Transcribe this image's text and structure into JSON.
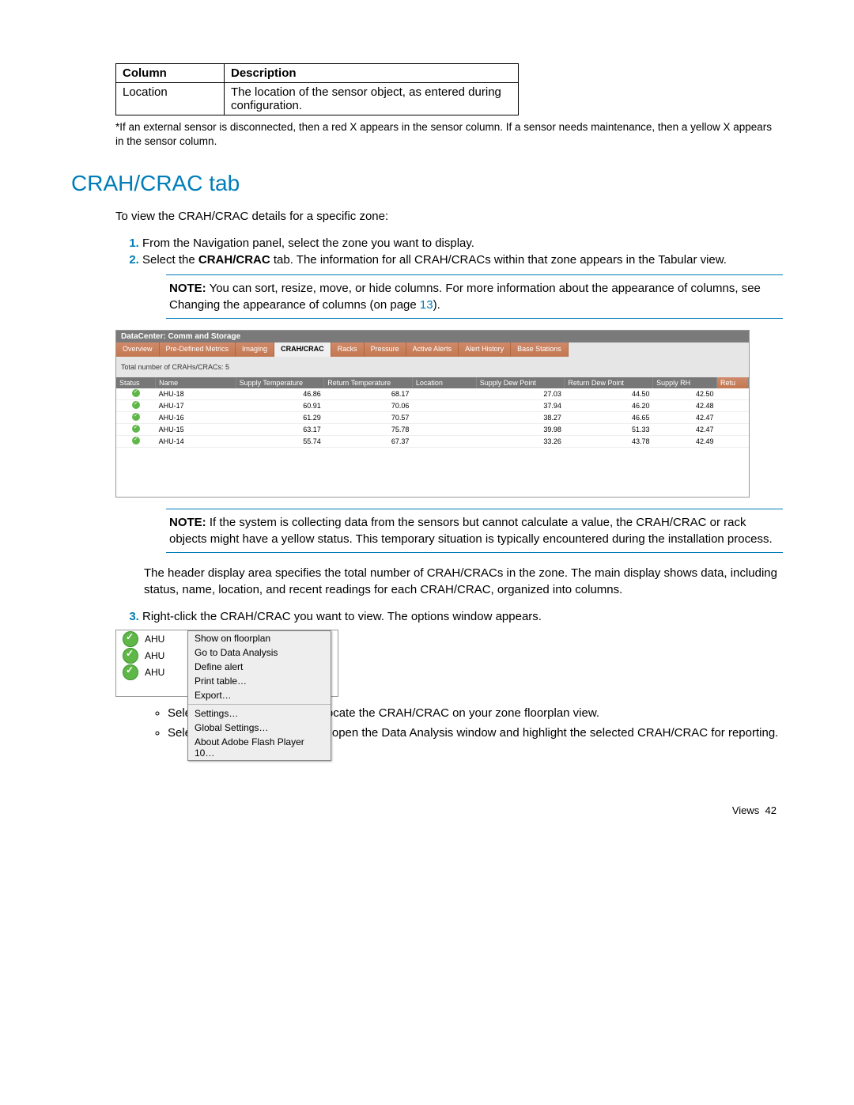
{
  "col_table": {
    "headers": [
      "Column",
      "Description"
    ],
    "row": [
      "Location",
      "The location of the sensor object, as entered during configuration."
    ]
  },
  "footnote": "*If an external sensor is disconnected, then a red X appears in the sensor column. If a sensor needs maintenance, then a yellow X appears in the sensor column.",
  "section_title": "CRAH/CRAC tab",
  "intro": "To view the CRAH/CRAC details for a specific zone:",
  "steps": {
    "s1": "From the Navigation panel, select the zone you want to display.",
    "s2_a": "Select the ",
    "s2_bold": "CRAH/CRAC",
    "s2_b": " tab. The information for all CRAH/CRACs within that zone appears in the Tabular view.",
    "s3": "Right-click the CRAH/CRAC you want to view. The options window appears."
  },
  "note1_label": "NOTE:",
  "note1": "You can sort, resize, move, or hide columns. For more information about the appearance of columns, see Changing the appearance of columns (on page ",
  "note1_page": "13",
  "note1_end": ").",
  "shot1": {
    "title": "DataCenter: Comm and Storage",
    "tabs": [
      "Overview",
      "Pre-Defined Metrics",
      "Imaging",
      "CRAH/CRAC",
      "Racks",
      "Pressure",
      "Active Alerts",
      "Alert History",
      "Base Stations"
    ],
    "active_tab_index": 3,
    "subline": "Total number of CRAHs/CRACs:  5",
    "headers": [
      "Status",
      "Name",
      "Supply Temperature",
      "Return Temperature",
      "Location",
      "Supply Dew Point",
      "Return Dew Point",
      "Supply RH",
      "Retu"
    ],
    "rows": [
      {
        "name": "AHU-18",
        "st": "46.86",
        "rt": "68.17",
        "loc": "",
        "sdp": "27.03",
        "rdp": "44.50",
        "srh": "42.50"
      },
      {
        "name": "AHU-17",
        "st": "60.91",
        "rt": "70.06",
        "loc": "",
        "sdp": "37.94",
        "rdp": "46.20",
        "srh": "42.48"
      },
      {
        "name": "AHU-16",
        "st": "61.29",
        "rt": "70.57",
        "loc": "",
        "sdp": "38.27",
        "rdp": "46.65",
        "srh": "42.47"
      },
      {
        "name": "AHU-15",
        "st": "63.17",
        "rt": "75.78",
        "loc": "",
        "sdp": "39.98",
        "rdp": "51.33",
        "srh": "42.47"
      },
      {
        "name": "AHU-14",
        "st": "55.74",
        "rt": "67.37",
        "loc": "",
        "sdp": "33.26",
        "rdp": "43.78",
        "srh": "42.49"
      }
    ]
  },
  "note2_label": "NOTE:",
  "note2": "If the system is collecting data from the sensors but cannot calculate a value, the CRAH/CRAC or rack objects might have a yellow status. This temporary situation is typically encountered during the installation process.",
  "para_after_note2": "The header display area specifies the total number of CRAH/CRACs in the zone. The main display shows data, including status, name, location, and recent readings for each CRAH/CRAC, organized into columns.",
  "shot2": {
    "rows": [
      "AHU",
      "AHU",
      "AHU"
    ],
    "menu": [
      "Show on floorplan",
      "Go to Data Analysis",
      "Define alert",
      "Print table…",
      "Export…",
      "-",
      "Settings…",
      "Global Settings…",
      "About Adobe Flash Player 10…"
    ]
  },
  "bullets": {
    "b1_a": "Select ",
    "b1_bold": "Show on floorplan",
    "b1_b": " to locate the CRAH/CRAC on your zone floorplan view.",
    "b2_a": "Select ",
    "b2_bold": "Go to Data Analysis",
    "b2_b": " to open the Data Analysis window and highlight the selected CRAH/CRAC for reporting."
  },
  "footer": {
    "label": "Views",
    "page": "42"
  }
}
